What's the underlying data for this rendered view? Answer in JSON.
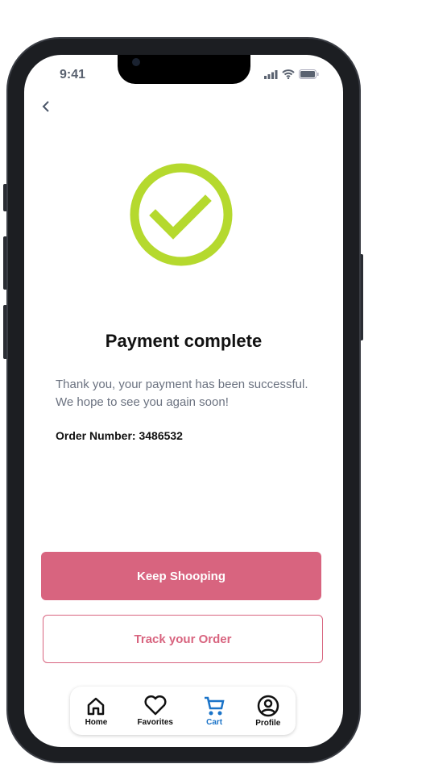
{
  "status_bar": {
    "time": "9:41"
  },
  "main": {
    "title": "Payment complete",
    "message_line1": "Thank you, your payment has been successful.",
    "message_line2": "We hope to see you again soon!",
    "order_label": "Order Number: 3486532"
  },
  "buttons": {
    "primary": "Keep Shooping",
    "secondary": "Track your Order"
  },
  "colors": {
    "accent": "#d8647f",
    "success": "#b5d92e",
    "active_tab": "#1a73c8"
  },
  "nav": {
    "items": [
      {
        "label": "Home",
        "icon": "home-icon"
      },
      {
        "label": "Favorites",
        "icon": "heart-icon"
      },
      {
        "label": "Cart",
        "icon": "cart-icon"
      },
      {
        "label": "Profile",
        "icon": "profile-icon"
      }
    ]
  }
}
